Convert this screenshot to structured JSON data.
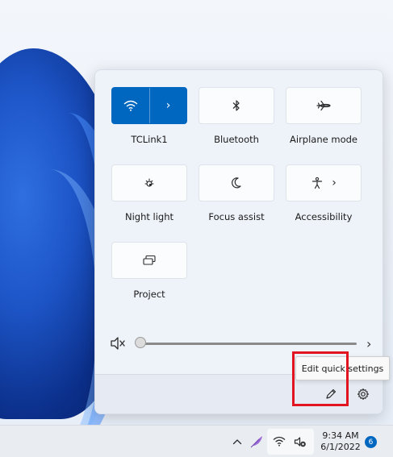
{
  "tiles": [
    {
      "label": "TCLink1",
      "icon": "wifi-icon",
      "active": true,
      "has_chevron": true
    },
    {
      "label": "Bluetooth",
      "icon": "bluetooth-icon"
    },
    {
      "label": "Airplane mode",
      "icon": "airplane-icon"
    },
    {
      "label": "Night light",
      "icon": "night-light-icon"
    },
    {
      "label": "Focus assist",
      "icon": "moon-icon"
    },
    {
      "label": "Accessibility",
      "icon": "accessibility-icon",
      "has_chevron": true
    },
    {
      "label": "Project",
      "icon": "project-icon"
    }
  ],
  "volume": {
    "muted": true,
    "level": 0
  },
  "footer": {
    "tooltip": "Edit quick settings"
  },
  "taskbar": {
    "time": "9:34 AM",
    "date": "6/1/2022",
    "notification_count": "6"
  },
  "colors": {
    "accent": "#0067c0",
    "highlight": "#e2141f"
  }
}
